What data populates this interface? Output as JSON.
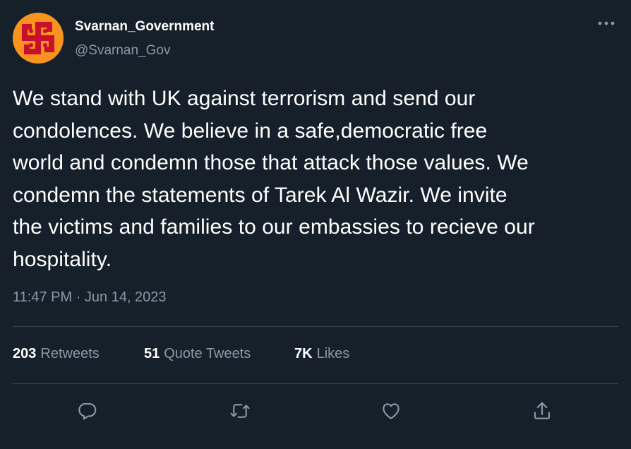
{
  "author": {
    "display_name": "Svarnan_Government",
    "handle": "@Svarnan_Gov",
    "avatar_icon": "swastika-emblem-icon",
    "avatar_colors": {
      "background": "#f7931e",
      "symbol": "#c8102e"
    }
  },
  "tweet": {
    "text": "We stand with UK against terrorism and send our\ncondolences. We believe in a safe,democratic free\nworld and condemn those that attack those values. We\ncondemn the statements of Tarek Al Wazir. We invite\nthe victims and families to our embassies to recieve our\nhospitality.",
    "timestamp": "11:47 PM · Jun 14, 2023"
  },
  "stats": [
    {
      "count": "203",
      "label": "Retweets"
    },
    {
      "count": "51",
      "label": "Quote Tweets"
    },
    {
      "count": "7K",
      "label": "Likes"
    }
  ],
  "actions": [
    {
      "name": "reply",
      "icon": "reply-icon"
    },
    {
      "name": "retweet",
      "icon": "retweet-icon"
    },
    {
      "name": "like",
      "icon": "heart-icon"
    },
    {
      "name": "share",
      "icon": "share-icon"
    }
  ],
  "menu": {
    "icon": "more-options-icon"
  },
  "theme": {
    "background": "#15202b",
    "text_primary": "#ffffff",
    "text_secondary": "#8b98a5",
    "divider": "#38444d"
  }
}
